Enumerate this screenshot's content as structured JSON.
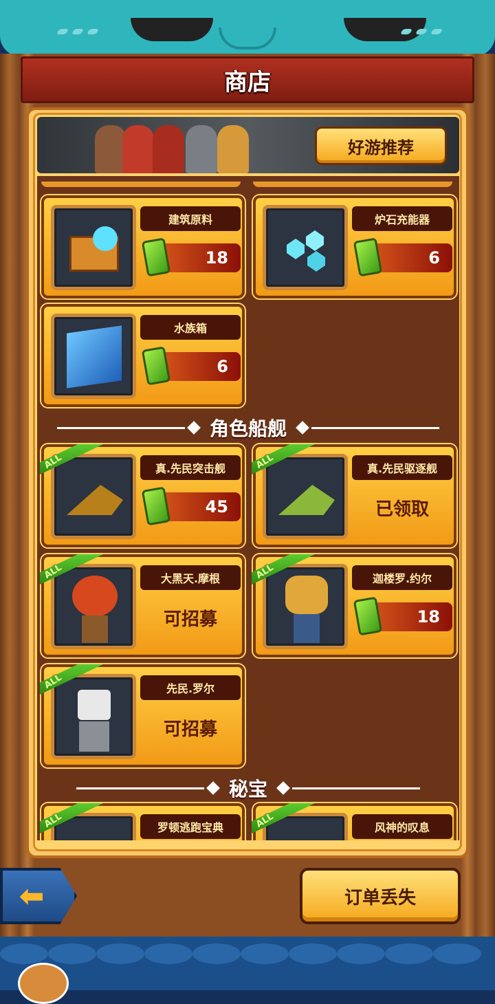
{
  "header": {
    "title": "商店"
  },
  "banner": {
    "button_label": "好游推荐"
  },
  "items": [
    {
      "name": "建筑原料",
      "price": "18",
      "status": "",
      "icon": "crate-icon",
      "all": false
    },
    {
      "name": "炉石充能器",
      "price": "6",
      "status": "",
      "icon": "crystal-icon",
      "all": false
    },
    {
      "name": "水族箱",
      "price": "6",
      "status": "",
      "icon": "aquarium-icon",
      "all": false
    }
  ],
  "sections": [
    {
      "title": "角色船舰"
    },
    {
      "title": "秘宝"
    }
  ],
  "ships": [
    {
      "name": "真.先民突击舰",
      "price": "45",
      "status": "",
      "icon": "ship-icon",
      "all": "ALL"
    },
    {
      "name": "真.先民驱逐舰",
      "price": "",
      "status": "已领取",
      "icon": "ship-icon",
      "all": "ALL"
    },
    {
      "name": "大黑天.摩根",
      "price": "",
      "status": "可招募",
      "icon": "character-icon",
      "all": "ALL"
    },
    {
      "name": "迦楼罗.约尔",
      "price": "18",
      "status": "",
      "icon": "character-icon",
      "all": "ALL"
    },
    {
      "name": "先民.罗尔",
      "price": "",
      "status": "可招募",
      "icon": "character-icon",
      "all": "ALL"
    }
  ],
  "treasures": [
    {
      "name": "罗顿逃跑宝典",
      "all": "ALL",
      "icon": "book-icon"
    },
    {
      "name": "风神的叹息",
      "all": "ALL",
      "icon": "wind-icon"
    }
  ],
  "footer": {
    "order_label": "订单丢失",
    "back_icon": "back-arrow-icon"
  }
}
